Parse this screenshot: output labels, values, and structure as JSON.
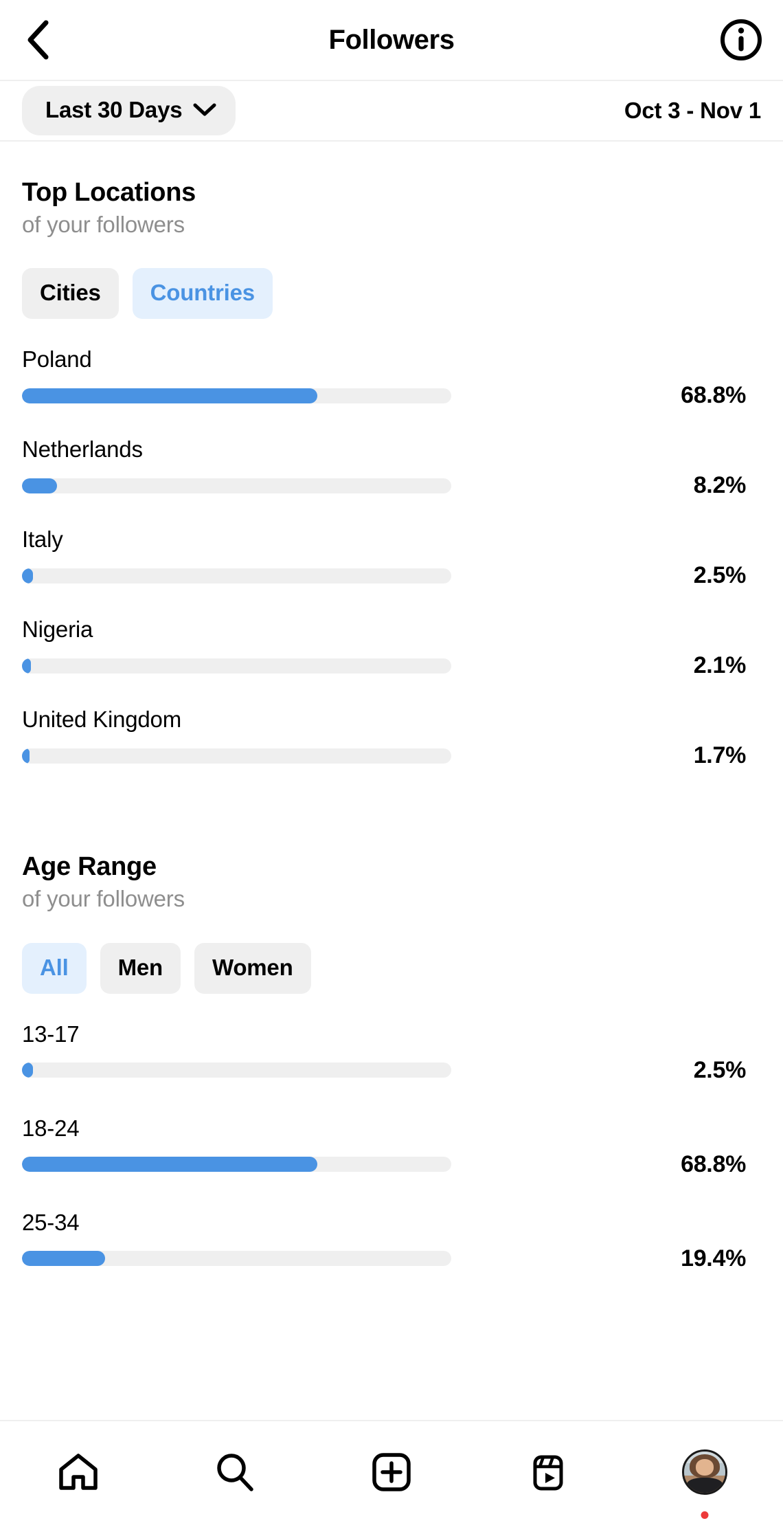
{
  "header": {
    "title": "Followers",
    "back_icon": "chevron-left-icon",
    "info_icon": "info-circle-icon"
  },
  "filter": {
    "range_label": "Last 30 Days",
    "range_chevron_icon": "chevron-down-icon",
    "date_range": "Oct 3 - Nov 1"
  },
  "colors": {
    "accent_blue": "#4a93e3",
    "tab_selected_bg": "#e4f0fd",
    "tab_bg": "#efefef",
    "track": "#efefef",
    "subtitle_gray": "#8e8e8e",
    "badge_red": "#ed3a3a"
  },
  "locations": {
    "title": "Top Locations",
    "subtitle": "of your followers",
    "tabs": [
      {
        "label": "Cities",
        "selected": false
      },
      {
        "label": "Countries",
        "selected": true
      }
    ]
  },
  "age": {
    "title": "Age Range",
    "subtitle": "of your followers",
    "tabs": [
      {
        "label": "All",
        "selected": true
      },
      {
        "label": "Men",
        "selected": false
      },
      {
        "label": "Women",
        "selected": false
      }
    ]
  },
  "bottom_nav": [
    {
      "name": "home",
      "icon": "home-icon"
    },
    {
      "name": "search",
      "icon": "search-icon"
    },
    {
      "name": "create",
      "icon": "plus-square-icon"
    },
    {
      "name": "reels",
      "icon": "reels-icon"
    },
    {
      "name": "profile",
      "icon": "avatar-icon",
      "badge": true
    }
  ],
  "chart_data": [
    {
      "type": "bar",
      "title": "Top Locations",
      "subtitle": "of your followers",
      "orientation": "horizontal",
      "xlabel": "",
      "ylabel": "",
      "grid": false,
      "legend": "none",
      "unit": "percent",
      "max_value": 100,
      "selected_tab": "Countries",
      "categories": [
        "Poland",
        "Netherlands",
        "Italy",
        "Nigeria",
        "United Kingdom"
      ],
      "values": [
        68.8,
        8.2,
        2.5,
        2.1,
        1.7
      ],
      "labels": [
        "68.8%",
        "8.2%",
        "2.5%",
        "2.1%",
        "1.7%"
      ]
    },
    {
      "type": "bar",
      "title": "Age Range",
      "subtitle": "of your followers",
      "orientation": "horizontal",
      "xlabel": "",
      "ylabel": "",
      "grid": false,
      "legend": "none",
      "unit": "percent",
      "max_value": 100,
      "selected_tab": "All",
      "categories": [
        "13-17",
        "18-24",
        "25-34"
      ],
      "values": [
        2.5,
        68.8,
        19.4
      ],
      "labels": [
        "2.5%",
        "68.8%",
        "19.4%"
      ]
    }
  ]
}
